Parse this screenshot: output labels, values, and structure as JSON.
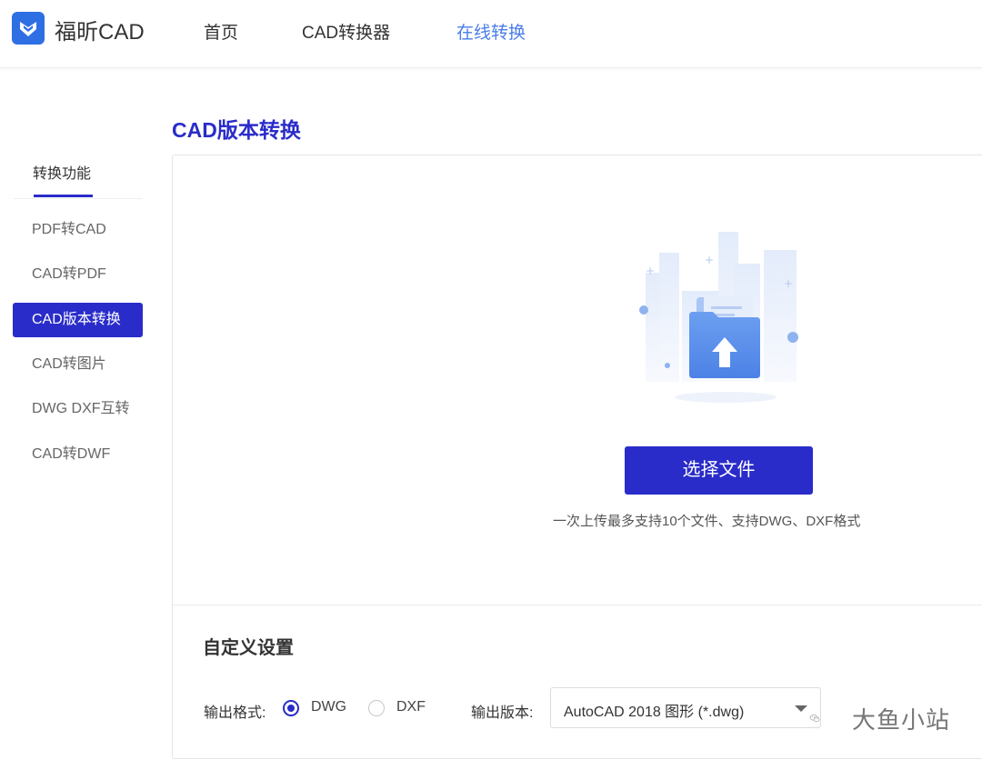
{
  "header": {
    "brand": "福昕CAD",
    "nav": [
      {
        "label": "首页",
        "active": false
      },
      {
        "label": "CAD转换器",
        "active": false
      },
      {
        "label": "在线转换",
        "active": true
      }
    ]
  },
  "sidebar": {
    "title": "转换功能",
    "items": [
      {
        "label": "PDF转CAD",
        "active": false
      },
      {
        "label": "CAD转PDF",
        "active": false
      },
      {
        "label": "CAD版本转换",
        "active": true
      },
      {
        "label": "CAD转图片",
        "active": false
      },
      {
        "label": "DWG DXF互转",
        "active": false
      },
      {
        "label": "CAD转DWF",
        "active": false
      }
    ]
  },
  "main": {
    "title": "CAD版本转换",
    "upload": {
      "button_label": "选择文件",
      "hint": "一次上传最多支持10个文件、支持DWG、DXF格式",
      "icon": "folder-upload-icon"
    },
    "settings": {
      "title": "自定义设置",
      "format_label": "输出格式:",
      "formats": [
        {
          "label": "DWG",
          "checked": true
        },
        {
          "label": "DXF",
          "checked": false
        }
      ],
      "version_label": "输出版本:",
      "version_value": "AutoCAD 2018 图形 (*.dwg)"
    }
  },
  "watermark": {
    "text": "大鱼小站",
    "icon": "wechat-icon"
  },
  "colors": {
    "primary": "#2a2cc9",
    "nav_active": "#4a7ee8",
    "logo": "#2f6fe4"
  }
}
